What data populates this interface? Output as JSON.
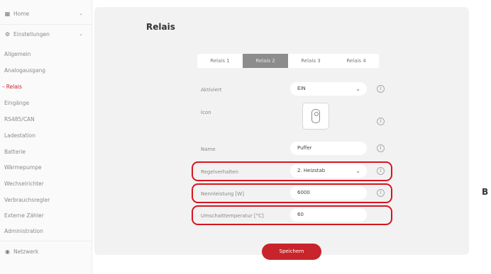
{
  "sidebar": {
    "home": "Home",
    "settings": "Einstellungen",
    "items": [
      "Allgemein",
      "Analogausgang",
      "Relais",
      "Eingänge",
      "RS485/CAN",
      "Ladestation",
      "Batterie",
      "Wärmepumpe",
      "Wechselrichter",
      "Verbrauchsregler",
      "Externe Zähler",
      "Administration"
    ],
    "active_item": "Relais",
    "network": "Netzwerk"
  },
  "page": {
    "title": "Relais"
  },
  "tabs": [
    "Relais 1",
    "Relais 2",
    "Relais 3",
    "Relais 4"
  ],
  "selected_tab": "Relais 2",
  "form": {
    "activated": {
      "label": "Aktiviert",
      "value": "EIN"
    },
    "icon": {
      "label": "Icon",
      "icon_name": "plug-icon"
    },
    "name": {
      "label": "Name",
      "value": "Puffer"
    },
    "control_behavior": {
      "label": "Regelverhalten",
      "value": "2. Heizstab"
    },
    "nominal_power": {
      "label": "Nennleistung [W]",
      "value": "6000"
    },
    "switch_temperature": {
      "label": "Umschalttemperatur [°C]",
      "value": "60"
    }
  },
  "save_label": "Speichern",
  "figure_label": "B",
  "colors": {
    "accent": "#c8242b",
    "highlight": "#d7151f",
    "selected_tab": "#8c8c8c"
  }
}
